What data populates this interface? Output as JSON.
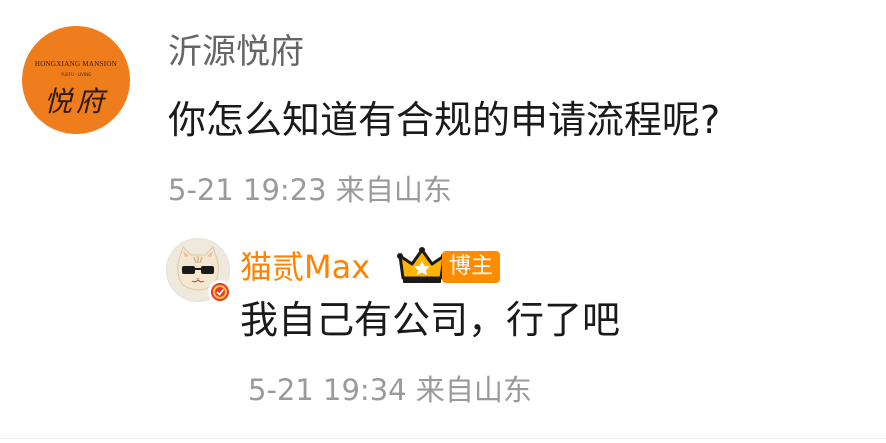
{
  "comment": {
    "avatar": {
      "brand_en": "HONGXIANG MANSION",
      "brand_sub": "YUEFU · LIVING",
      "brand_cn": "悦府"
    },
    "username": "沂源悦府",
    "text": "你怎么知道有合规的申请流程呢?",
    "meta": "5-21 19:23 来自山东"
  },
  "reply": {
    "username": "猫贰Max",
    "badge_label": "博主",
    "text": "我自己有公司，行了吧",
    "meta": "5-21 19:34 来自山东"
  },
  "colors": {
    "accent": "#ff8200",
    "avatar_bg": "#f07d1c",
    "text_primary": "#1a1a1a",
    "text_secondary": "#9a9a9a",
    "username_gray": "#666666",
    "verified_red": "#e8392b"
  },
  "icons": {
    "crown": "crown-icon",
    "verified": "verified-badge-icon"
  }
}
